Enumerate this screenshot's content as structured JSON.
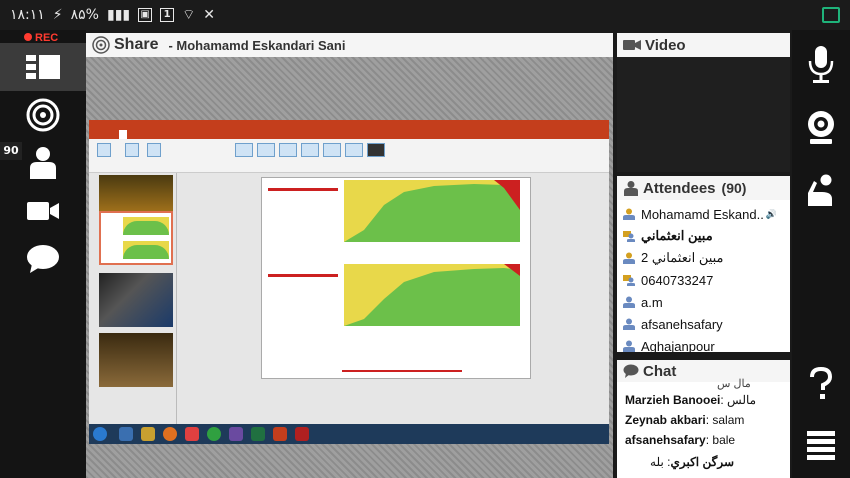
{
  "status_bar": {
    "time": "۱۸:۱۱",
    "battery": "۸۵%",
    "notification_count": "1"
  },
  "recording": {
    "label": "REC"
  },
  "left_sidebar": {
    "attendee_badge": "90"
  },
  "share_panel": {
    "title": "Share",
    "presenter": "- Mohamamd Eskandari Sani"
  },
  "video_panel": {
    "title": "Video"
  },
  "attendees_panel": {
    "title": "Attendees",
    "count": "(90)",
    "items": [
      {
        "name": "Mohamamd Eskand..",
        "role": "host"
      },
      {
        "name": "مبين انعثماني",
        "role": "presenter"
      },
      {
        "name": "مبين انعثماني 2",
        "role": "host"
      },
      {
        "name": "0640733247",
        "role": "presenter"
      },
      {
        "name": "a.m",
        "role": "participant"
      },
      {
        "name": "afsanehsafary",
        "role": "participant"
      },
      {
        "name": "Aghajanpour",
        "role": "participant"
      }
    ]
  },
  "chat_panel": {
    "title": "Chat",
    "partial_top": "مال س",
    "messages": [
      {
        "sender": "Marzieh Banooei",
        "text": "مالس"
      },
      {
        "sender": "Zeynab akbari",
        "text": "salam"
      },
      {
        "sender": "afsanehsafary",
        "text": "bale"
      },
      {
        "sender": "سرگن اكبري",
        "text": "بله"
      }
    ]
  },
  "colors": {
    "accent_red": "#ff3b30",
    "ppt_red": "#c43e1c",
    "panel_bg": "#f5f5f5",
    "dark_bg": "#141414"
  }
}
